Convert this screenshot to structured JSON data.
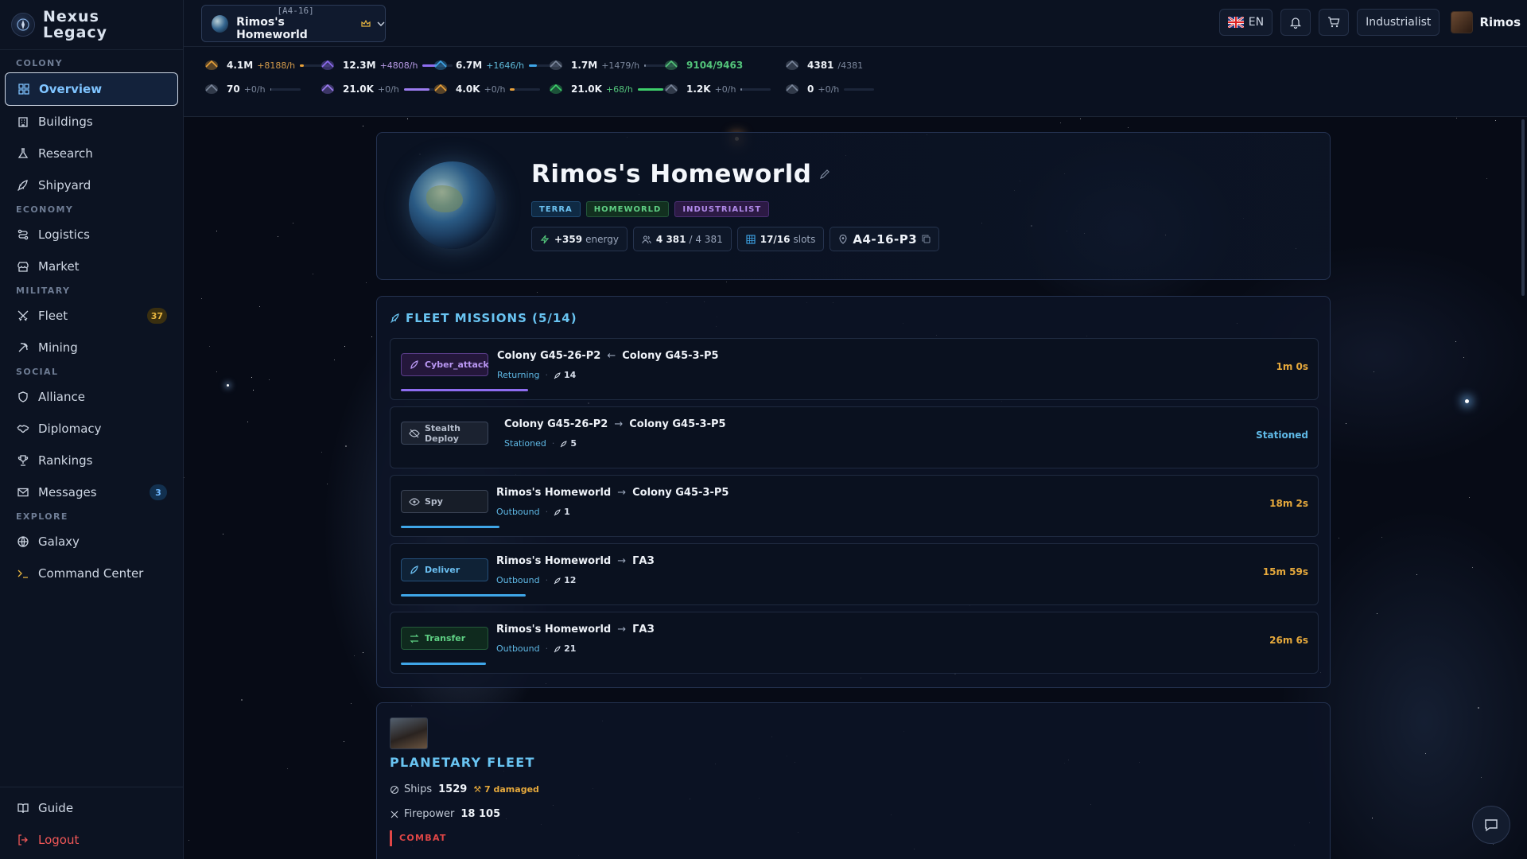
{
  "app": {
    "name_line1": "Nexus",
    "name_line2": "Legacy"
  },
  "sidebar": {
    "sections": [
      {
        "label": "COLONY",
        "items": [
          {
            "label": "Overview",
            "icon": "grid-icon",
            "active": true
          },
          {
            "label": "Buildings",
            "icon": "building-icon"
          },
          {
            "label": "Research",
            "icon": "flask-icon"
          },
          {
            "label": "Shipyard",
            "icon": "rocket-icon"
          }
        ]
      },
      {
        "label": "ECONOMY",
        "items": [
          {
            "label": "Logistics",
            "icon": "route-icon"
          },
          {
            "label": "Market",
            "icon": "store-icon"
          }
        ]
      },
      {
        "label": "MILITARY",
        "items": [
          {
            "label": "Fleet",
            "icon": "swords-icon",
            "badge": "37"
          },
          {
            "label": "Mining",
            "icon": "pickaxe-icon"
          }
        ]
      },
      {
        "label": "SOCIAL",
        "items": [
          {
            "label": "Alliance",
            "icon": "shield-icon"
          },
          {
            "label": "Diplomacy",
            "icon": "handshake-icon"
          },
          {
            "label": "Rankings",
            "icon": "trophy-icon"
          },
          {
            "label": "Messages",
            "icon": "mail-icon",
            "badge": "3"
          }
        ]
      },
      {
        "label": "EXPLORE",
        "items": [
          {
            "label": "Galaxy",
            "icon": "globe-icon"
          },
          {
            "label": "Command Center",
            "icon": "terminal-icon"
          }
        ]
      }
    ],
    "bottom": {
      "guide": "Guide",
      "logout": "Logout"
    }
  },
  "topbar": {
    "planet_coord": "[A4-16]",
    "planet_name": "Rimos's Homeworld",
    "language": "EN",
    "class_label": "Industrialist",
    "username": "Rimos"
  },
  "resources": {
    "row1": [
      {
        "value": "4.1M",
        "rate": "+8188/h",
        "color": "#e8a13a",
        "fill": 0.12
      },
      {
        "value": "12.3M",
        "rate": "+4808/h",
        "color": "#8e6df0",
        "fill": 0.45
      },
      {
        "value": "6.7M",
        "rate": "+1646/h",
        "color": "#3fa6e8",
        "fill": 0.25
      },
      {
        "value": "1.7M",
        "rate": "+1479/h",
        "color": "#7b879c",
        "fill": 0.05
      },
      {
        "value": "9104/9463",
        "rate": "",
        "color": "#53c47a",
        "fill": 0
      },
      {
        "value": "4381",
        "rate": "/4381",
        "color": "#7b879c",
        "fill": 0
      }
    ],
    "row2": [
      {
        "value": "70",
        "rate": "+0/h",
        "color": "#7b879c",
        "fill": 0.03
      },
      {
        "value": "21.0K",
        "rate": "+0/h",
        "color": "#9c7cf0",
        "fill": 0.85
      },
      {
        "value": "4.0K",
        "rate": "+0/h",
        "color": "#e8a13a",
        "fill": 0.15
      },
      {
        "value": "21.0K",
        "rate": "+68/h",
        "color": "#3ecf6a",
        "fill": 0.85
      },
      {
        "value": "1.2K",
        "rate": "+0/h",
        "color": "#7b879c",
        "fill": 0.05
      },
      {
        "value": "0",
        "rate": "+0/h",
        "color": "#7b879c",
        "fill": 0
      }
    ]
  },
  "planet": {
    "name": "Rimos's Homeworld",
    "tags": [
      "TERRA",
      "HOMEWORLD",
      "INDUSTRIALIST"
    ],
    "energy_value": "+359",
    "energy_label": "energy",
    "pop_current": "4 381",
    "pop_max": "/ 4 381",
    "slots_value": "17/16",
    "slots_label": "slots",
    "coord": "A4-16-P3"
  },
  "fleet_missions": {
    "title": "FLEET MISSIONS (5/14)",
    "missions": [
      {
        "type": "Cyber_attack",
        "style": "cyber",
        "from": "Colony G45-26-P2",
        "arrow": "←",
        "to": "Colony G45-3-P5",
        "status": "Returning",
        "ships": "14",
        "time": "1m 0s",
        "progress": 0.58,
        "progress_color": "#8e6df0"
      },
      {
        "type": "Stealth Deploy",
        "style": "stealth",
        "from": "Colony G45-26-P2",
        "arrow": "→",
        "to": "Colony G45-3-P5",
        "status": "Stationed",
        "ships": "5",
        "time": "Stationed",
        "progress": 0,
        "progress_color": "#3fa6e8"
      },
      {
        "type": "Spy",
        "style": "spy",
        "from": "Rimos's Homeworld",
        "arrow": "→",
        "to": "Colony G45-3-P5",
        "status": "Outbound",
        "ships": "1",
        "time": "18m 2s",
        "progress": 0.45,
        "progress_color": "#3fa6e8"
      },
      {
        "type": "Deliver",
        "style": "deliver",
        "from": "Rimos's Homeworld",
        "arrow": "→",
        "to": "ГАЗ",
        "status": "Outbound",
        "ships": "12",
        "time": "15m 59s",
        "progress": 0.57,
        "progress_color": "#3fa6e8"
      },
      {
        "type": "Transfer",
        "style": "transfer",
        "from": "Rimos's Homeworld",
        "arrow": "→",
        "to": "ГАЗ",
        "status": "Outbound",
        "ships": "21",
        "time": "26m 6s",
        "progress": 0.39,
        "progress_color": "#3fa6e8"
      }
    ]
  },
  "planetary_fleet": {
    "title": "PLANETARY FLEET",
    "ships_label": "Ships",
    "ships_value": "1529",
    "damaged": "7 damaged",
    "firepower_label": "Firepower",
    "firepower_value": "18 105",
    "combat_label": "COMBAT"
  }
}
